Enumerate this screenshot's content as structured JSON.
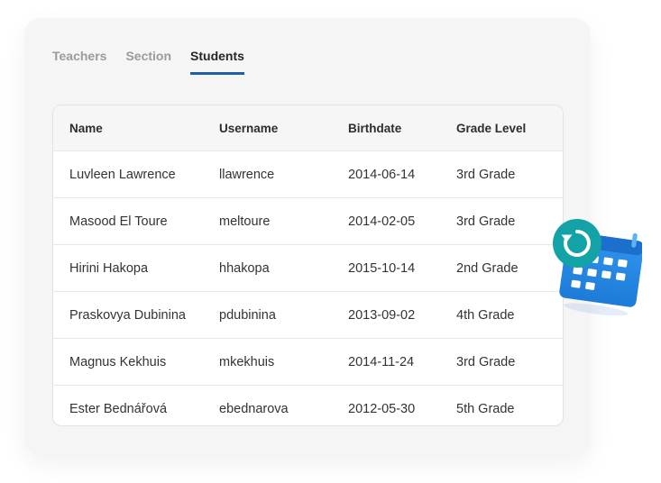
{
  "tabs": [
    "Teachers",
    "Section",
    "Students"
  ],
  "active_tab": "Students",
  "table": {
    "headers": [
      "Name",
      "Username",
      "Birthdate",
      "Grade Level"
    ],
    "rows": [
      [
        "Luvleen Lawrence",
        "llawrence",
        "2014-06-14",
        "3rd Grade"
      ],
      [
        "Masood El Toure",
        "meltoure",
        "2014-02-05",
        "3rd Grade"
      ],
      [
        "Hirini Hakopa",
        "hhakopa",
        "2015-10-14",
        "2nd Grade"
      ],
      [
        "Praskovya Dubinina",
        "pdubinina",
        "2013-09-02",
        "4th Grade"
      ],
      [
        "Magnus Kekhuis",
        "mkekhuis",
        "2014-11-24",
        "3rd Grade"
      ],
      [
        "Ester Bednářová",
        "ebednarova",
        "2012-05-30",
        "5th Grade"
      ]
    ]
  },
  "colors": {
    "accent": "#1f5fa8",
    "calendar_blue": "#2489e4",
    "refresh_teal": "#13a3a7"
  },
  "icons": [
    "calendar-icon",
    "refresh-icon"
  ]
}
